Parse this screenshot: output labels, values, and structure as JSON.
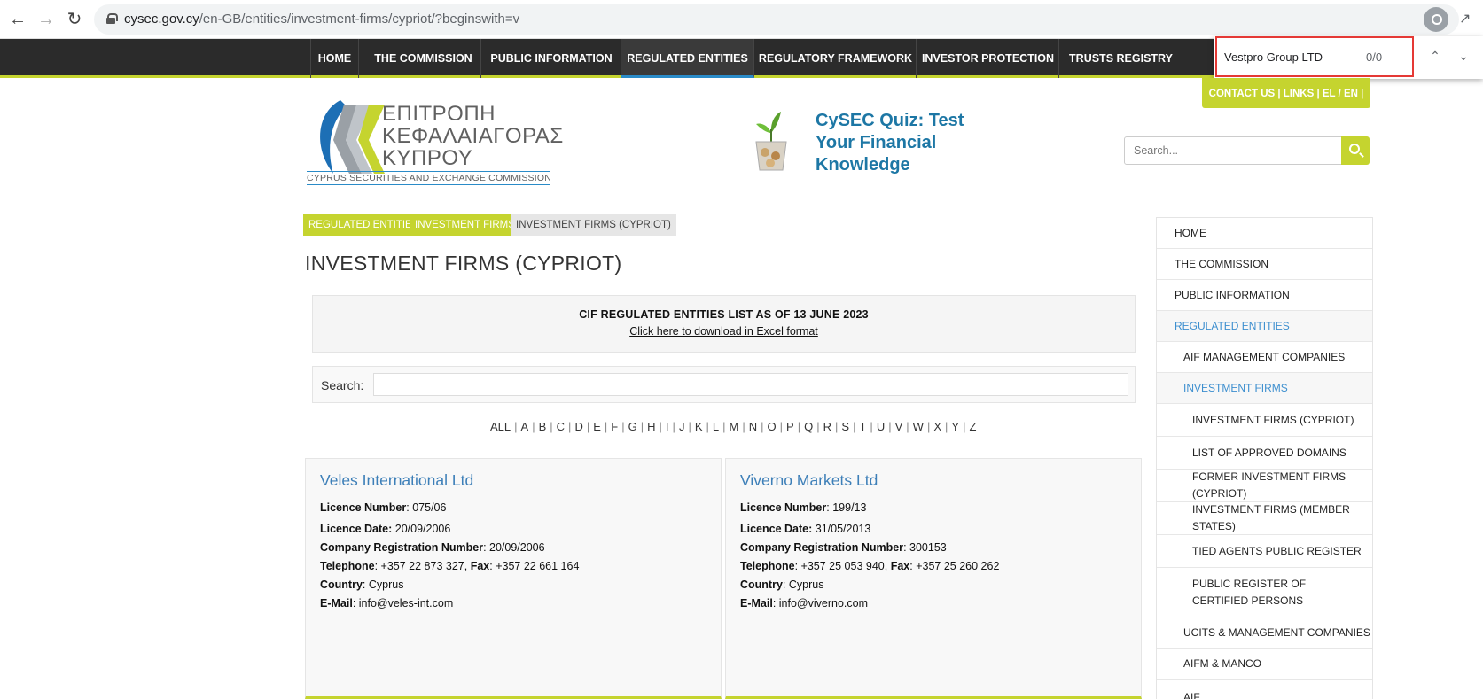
{
  "browser": {
    "url_main": "cysec.gov.cy",
    "url_rest": "/en-GB/entities/investment-firms/cypriot/?beginswith=v"
  },
  "find_bar": {
    "query": "Vestpro Group LTD",
    "count": "0/0"
  },
  "nav": {
    "items": [
      "HOME",
      "THE COMMISSION",
      "PUBLIC INFORMATION",
      "REGULATED ENTITIES",
      "REGULATORY FRAMEWORK",
      "INVESTOR PROTECTION",
      "TRUSTS REGISTRY"
    ],
    "active": "REGULATED ENTITIES"
  },
  "top_links": {
    "text": "CONTACT US  |  LINKS  |   EL / EN |"
  },
  "logo": {
    "line1": "ΕΠΙΤΡΟΠΗ",
    "line2": "ΚΕΦΑΛΑΙΑΓΟΡΑΣ",
    "line3": "ΚΥΠΡΟΥ",
    "subtitle": "CYPRUS SECURITIES AND EXCHANGE COMMISSION"
  },
  "quiz": {
    "text": "CySEC Quiz: Test Your Financial Knowledge"
  },
  "header_search": {
    "placeholder": "Search..."
  },
  "breadcrumb": [
    "REGULATED ENTITIES",
    "INVESTMENT FIRMS",
    "INVESTMENT FIRMS (CYPRIOT)"
  ],
  "page_title": "INVESTMENT FIRMS (CYPRIOT)",
  "list_header": {
    "title": "CIF REGULATED ENTITIES LIST AS OF 13 JUNE 2023",
    "download_link": "Click here to download in Excel format"
  },
  "table_search": {
    "label": "Search:"
  },
  "alphabet": [
    "ALL",
    "A",
    "B",
    "C",
    "D",
    "E",
    "F",
    "G",
    "H",
    "I",
    "J",
    "K",
    "L",
    "M",
    "N",
    "O",
    "P",
    "Q",
    "R",
    "S",
    "T",
    "U",
    "V",
    "W",
    "X",
    "Y",
    "Z"
  ],
  "labels": {
    "licence_number": "Licence Number",
    "licence_date": "Licence Date:",
    "company_reg": "Company Registration Number",
    "telephone": "Telephone",
    "fax": "Fax",
    "country": "Country",
    "email": "E-Mail"
  },
  "cards": [
    {
      "name": "Veles International Ltd",
      "licence_number": "075/06",
      "licence_date": "20/09/2006",
      "company_reg": "20/09/2006",
      "telephone": "+357 22 873 327",
      "fax": "+357 22 661 164",
      "country": "Cyprus",
      "email": "info@veles-int.com"
    },
    {
      "name": "Viverno Markets Ltd",
      "licence_number": "199/13",
      "licence_date": "31/05/2013",
      "company_reg": "300153",
      "telephone": "+357 25 053 940",
      "fax": "+357 25 260 262",
      "country": "Cyprus",
      "email": "info@viverno.com"
    }
  ],
  "sidebar": [
    "HOME",
    "THE COMMISSION",
    "PUBLIC INFORMATION",
    "REGULATED ENTITIES",
    "AIF MANAGEMENT COMPANIES",
    "INVESTMENT FIRMS",
    "INVESTMENT FIRMS (CYPRIOT)",
    "LIST OF APPROVED DOMAINS",
    "FORMER INVESTMENT FIRMS (CYPRIOT)",
    "INVESTMENT FIRMS (MEMBER STATES)",
    "TIED AGENTS PUBLIC REGISTER",
    "PUBLIC REGISTER OF CERTIFIED PERSONS",
    "UCITS & MANAGEMENT COMPANIES",
    "AIFM & MANCO",
    "AIF"
  ],
  "colors": {
    "accent_green": "#c5d42f",
    "link_blue": "#3d7fb8",
    "nav_dark": "#2b2b2b"
  }
}
